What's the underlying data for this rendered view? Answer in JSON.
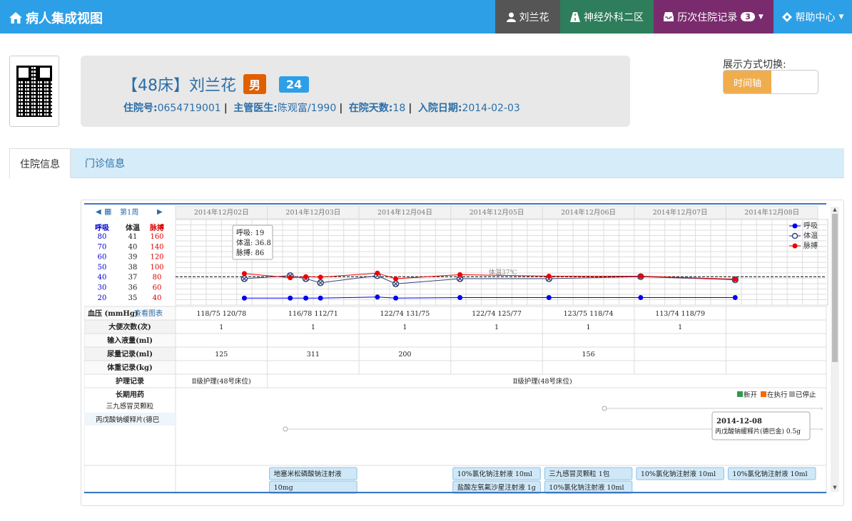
{
  "header": {
    "title": "病人集成视图",
    "user": "刘兰花",
    "dept": "神经外科二区",
    "history_label": "历次住院记录",
    "history_count": "3",
    "help": "帮助中心"
  },
  "patient": {
    "bed_name": "【48床】刘兰花",
    "sex": "男",
    "age": "24",
    "admission_no_label": "住院号:",
    "admission_no": "0654719001",
    "doctor_label": "主管医生:",
    "doctor": "陈观富/1990",
    "days_label": "在院天数:",
    "days": "18",
    "admit_date_label": "入院日期:",
    "admit_date": "2014-02-03"
  },
  "view_mode": {
    "label": "展示方式切换:",
    "option": "时间轴"
  },
  "tabs": [
    "住院信息",
    "门诊信息"
  ],
  "chart_data": {
    "type": "line",
    "week_label": "第1周",
    "dates": [
      "2014年12月02日",
      "2014年12月03日",
      "2014年12月04日",
      "2014年12月05日",
      "2014年12月06日",
      "2014年12月07日",
      "2014年12月08日"
    ],
    "axis_headers": [
      "呼吸",
      "体温",
      "脉搏"
    ],
    "resp_ticks": [
      "80",
      "70",
      "60",
      "50",
      "40",
      "30",
      "20"
    ],
    "temp_ticks": [
      "41",
      "40",
      "39",
      "38",
      "37",
      "36",
      "35"
    ],
    "pulse_ticks": [
      "160",
      "140",
      "120",
      "100",
      "80",
      "60",
      "40"
    ],
    "legend": [
      "呼吸",
      "体温",
      "脉搏"
    ],
    "ref_line_label": "体温37℃",
    "series": [
      {
        "name": "呼吸",
        "color": "#0000ee",
        "points": [
          [
            0.75,
            19
          ],
          [
            1.25,
            19
          ],
          [
            1.42,
            19
          ],
          [
            1.58,
            19
          ],
          [
            2.2,
            20
          ],
          [
            2.4,
            19
          ],
          [
            3.1,
            19.5
          ],
          [
            4.07,
            19.5
          ],
          [
            5.07,
            19.5
          ],
          [
            6.1,
            19.5
          ]
        ]
      },
      {
        "name": "体温",
        "color": "#334477",
        "points": [
          [
            0.75,
            36.8
          ],
          [
            1.25,
            37.1
          ],
          [
            1.42,
            36.8
          ],
          [
            1.58,
            36.4
          ],
          [
            2.2,
            37.1
          ],
          [
            2.4,
            36.3
          ],
          [
            3.1,
            36.8
          ],
          [
            4.07,
            36.8
          ],
          [
            5.07,
            37.0
          ],
          [
            6.1,
            36.7
          ]
        ]
      },
      {
        "name": "脉搏",
        "color": "#ee0000",
        "points": [
          [
            0.75,
            86
          ],
          [
            1.25,
            78
          ],
          [
            1.42,
            80
          ],
          [
            1.58,
            79
          ],
          [
            2.2,
            87
          ],
          [
            2.4,
            76
          ],
          [
            3.1,
            84
          ],
          [
            4.07,
            81
          ],
          [
            5.07,
            81
          ],
          [
            6.1,
            75
          ]
        ]
      }
    ],
    "tooltip": {
      "resp": "呼吸: 19",
      "temp": "体温: 36.8",
      "pulse": "脉搏: 86"
    },
    "rows": [
      {
        "label": "血压 (mmHg)",
        "link": "查看图表",
        "values": [
          "118/75  120/78",
          "116/78  112/71",
          "122/74  131/75",
          "122/74  125/77",
          "123/75  118/74",
          "113/74  118/79",
          ""
        ]
      },
      {
        "label": "大便次数(次)",
        "values": [
          "1",
          "1",
          "1",
          "1",
          "1",
          "1",
          ""
        ]
      },
      {
        "label": "输入液量(ml)",
        "values": [
          "",
          "",
          "",
          "",
          "",
          "",
          ""
        ]
      },
      {
        "label": "尿量记录(ml)",
        "values": [
          "125",
          "311",
          "200",
          "",
          "156",
          "",
          ""
        ]
      },
      {
        "label": "体重记录(kg)",
        "values": [
          "",
          "",
          "",
          "",
          "",
          "",
          ""
        ]
      }
    ],
    "nursing": {
      "label": "护理记录",
      "first": "Ⅱ级护理(48号床位)",
      "rest": "Ⅱ级护理(48号床位)"
    },
    "longterm": {
      "label": "长期用药",
      "drugs": [
        "三九感冒灵颗粒",
        "丙戊酸钠缓释片(德巴"
      ],
      "legend": [
        "新开",
        "在执行",
        "已停止"
      ],
      "legend_colors": [
        "#2e9b4a",
        "#ff6600",
        "#aaaaaa"
      ],
      "popup_date": "2014-12-08",
      "popup_drug": "丙戊酸钠缓释片(德巴金) 0.5g"
    },
    "shortterm": [
      {
        "day": 1,
        "text1": "地塞米松磷酸钠注射液",
        "text2": "10mg"
      },
      {
        "day": 3,
        "text1": "10%氯化钠注射液 10ml",
        "text2": "盐酸左氧氟沙星注射液 1g"
      },
      {
        "day": 4,
        "text1": "三九感冒灵颗粒 1包",
        "text2": "10%氯化钠注射液 10ml"
      },
      {
        "day": 5,
        "text1": "10%氯化钠注射液 10ml",
        "text2": ""
      },
      {
        "day": 6,
        "text1": "10%氯化钠注射液 10ml",
        "text2": ""
      }
    ]
  }
}
